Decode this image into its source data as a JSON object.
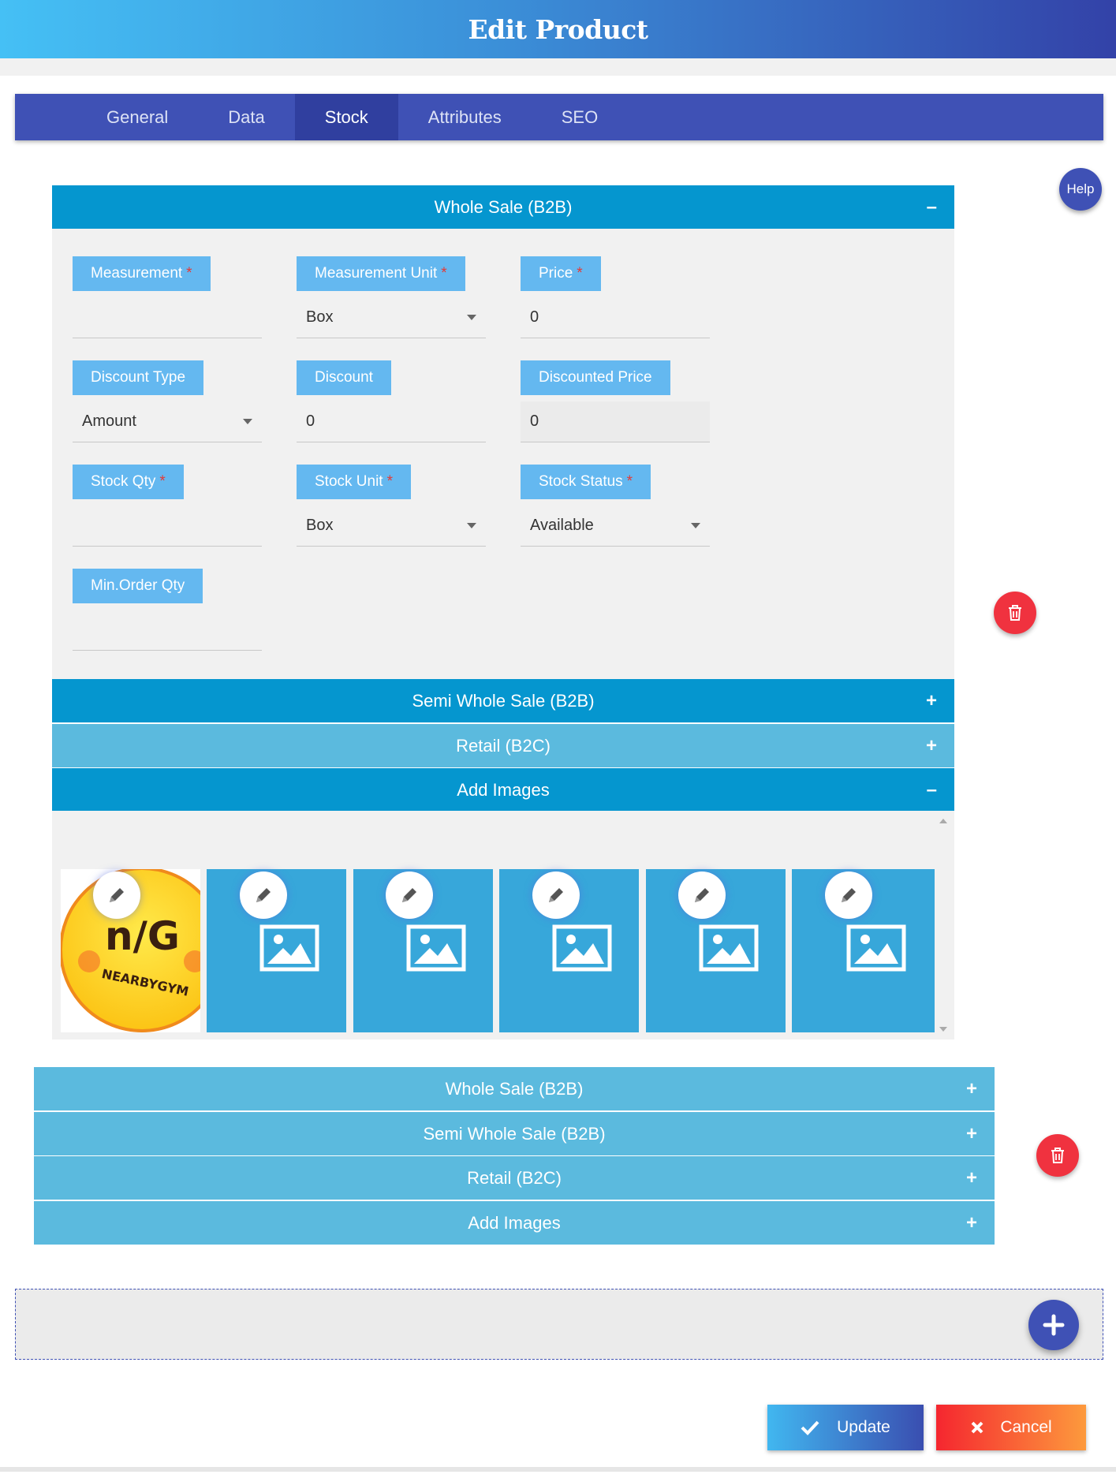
{
  "header": {
    "title": "Edit Product"
  },
  "tabs": [
    {
      "label": "General",
      "active": false
    },
    {
      "label": "Data",
      "active": false
    },
    {
      "label": "Stock",
      "active": true
    },
    {
      "label": "Attributes",
      "active": false
    },
    {
      "label": "SEO",
      "active": false
    }
  ],
  "help": {
    "label": "Help"
  },
  "group1": {
    "sections": [
      {
        "label": "Whole Sale (B2B)",
        "sign": "–"
      },
      {
        "label": "Semi Whole Sale (B2B)",
        "sign": "+"
      },
      {
        "label": "Retail (B2C)",
        "sign": "+"
      },
      {
        "label": "Add Images",
        "sign": "–"
      }
    ],
    "fields": {
      "measurement": {
        "label": "Measurement",
        "required": "*",
        "value": ""
      },
      "measurement_unit": {
        "label": "Measurement Unit",
        "required": "*",
        "value": "Box"
      },
      "price": {
        "label": "Price",
        "required": "*",
        "value": "0"
      },
      "discount_type": {
        "label": "Discount Type",
        "value": "Amount"
      },
      "discount": {
        "label": "Discount",
        "value": "0"
      },
      "discounted_price": {
        "label": "Discounted Price",
        "value": "0"
      },
      "stock_qty": {
        "label": "Stock Qty",
        "required": "*",
        "value": ""
      },
      "stock_unit": {
        "label": "Stock Unit",
        "required": "*",
        "value": "Box"
      },
      "stock_status": {
        "label": "Stock Status",
        "required": "*",
        "value": "Available"
      },
      "min_order_qty": {
        "label": "Min.Order Qty",
        "value": ""
      }
    },
    "images": {
      "logo_text": "n/G",
      "logo_subtext": "NEARBYGYM",
      "placeholder_count": 5
    }
  },
  "group2": {
    "sections": [
      {
        "label": "Whole Sale (B2B)",
        "sign": "+"
      },
      {
        "label": "Semi Whole Sale (B2B)",
        "sign": "+"
      },
      {
        "label": "Retail (B2C)",
        "sign": "+"
      },
      {
        "label": "Add Images",
        "sign": "+"
      }
    ]
  },
  "actions": {
    "update_label": "Update",
    "cancel_label": "Cancel"
  },
  "icons": {
    "trash": "trash-icon",
    "pencil": "pencil-icon",
    "image": "image-placeholder-icon",
    "plus": "plus-icon",
    "check": "check-icon",
    "close": "close-icon"
  },
  "colors": {
    "primary": "#3f51b5",
    "accent": "#0596cf",
    "danger": "#f0323f"
  }
}
